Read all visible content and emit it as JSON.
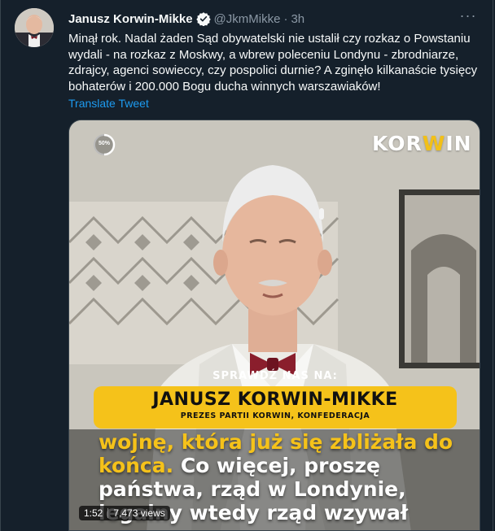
{
  "tweet": {
    "author_name": "Janusz Korwin-Mikke",
    "handle": "@JkmMikke",
    "dot": "·",
    "time": "3h",
    "more_label": "···",
    "text": "Minął rok. Nadal żaden Sąd obywatelski nie ustalił czy rozkaz o Powstaniu wydali - na rozkaz z Moskwy, a wbrew poleceniu Londynu - zbrodniarze, zdrajcy, agenci sowieccy, czy pospolici durnie? A zginęło kilkanaście tysięcy bohaterów i 200.000 Bogu ducha winnych warszawiaków!",
    "translate_label": "Translate Tweet"
  },
  "video": {
    "logo_prefix": "KOR",
    "logo_accent": "W",
    "logo_suffix": "IN",
    "progress_label": "50%",
    "progress": 0.5,
    "check_label": "SPRAWDŹ NAS NA:",
    "banner_name": "JANUSZ KORWIN-MIKKE",
    "banner_subtitle": "PREZES PARTII KORWIN, KONFEDERACJA",
    "caption_hl": "wojnę, która już się zbliżała do końca.",
    "caption_rest": " Co więcej, proszę państwa, rząd w Londynie, legalny wtedy rząd wzywał",
    "duration": "1:52",
    "views": "7,473 views"
  },
  "colors": {
    "background": "#15202b",
    "link": "#1d9bf0",
    "secondary_text": "#8b98a5",
    "banner": "#f5c21a",
    "bow_tie": "#8a1e2c"
  },
  "icons": {
    "verified": "verified-badge-icon",
    "more": "more-options-icon"
  }
}
